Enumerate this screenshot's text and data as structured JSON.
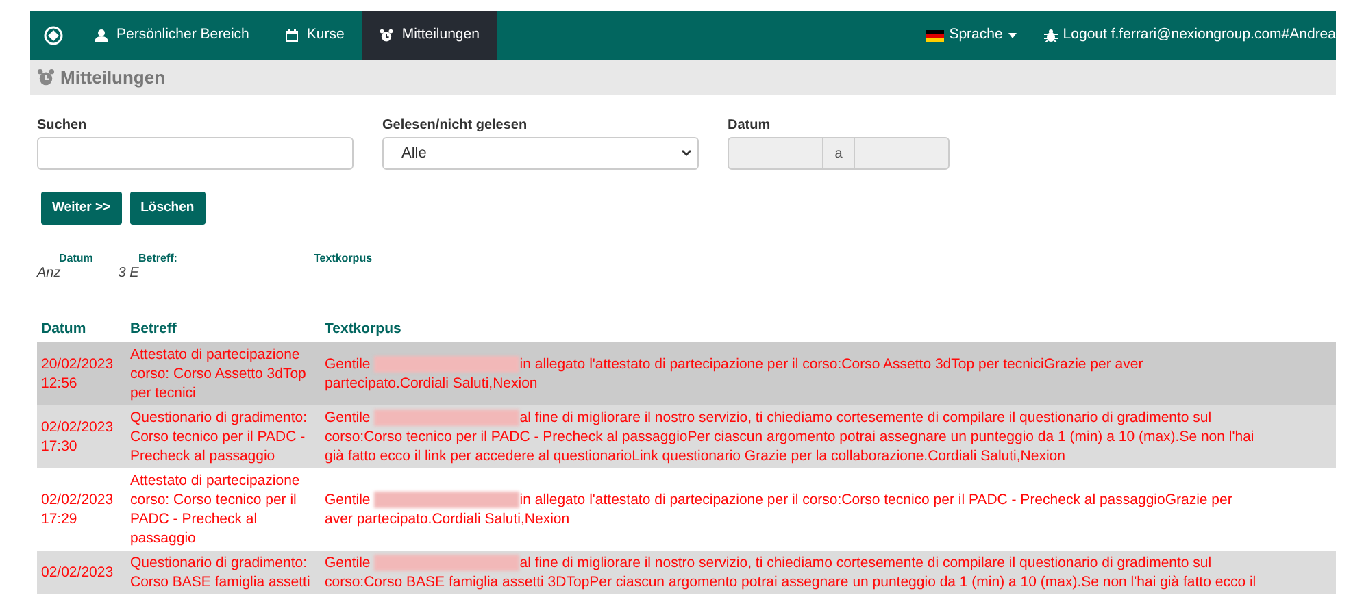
{
  "nav": {
    "items": [
      {
        "label": "Persönlicher Bereich",
        "selected": false
      },
      {
        "label": "Kurse",
        "selected": false
      },
      {
        "label": "Mitteilungen",
        "selected": true
      }
    ],
    "language": "Sprache",
    "logout": "Logout f.ferrari@nexiongroup.com#Andrea"
  },
  "page_title": "Mitteilungen",
  "filters": {
    "search_label": "Suchen",
    "read_label": "Gelesen/nicht gelesen",
    "read_value": "Alle",
    "date_label": "Datum",
    "date_separator": "a"
  },
  "buttons": [
    "Weiter >>",
    "Löschen"
  ],
  "result_fragments": [
    "Anz",
    "3 E"
  ],
  "floating_header": [
    "Datum",
    "Betreff:",
    "Textkorpus"
  ],
  "table": {
    "columns": [
      "Datum",
      "Betreff",
      "Textkorpus"
    ],
    "rows": [
      {
        "selected": true,
        "date": "20/02/2023",
        "time": "12:56",
        "subject": "Attestato di partecipazione corso: Corso Assetto 3dTop per tecnici",
        "greeting": "Gentile",
        "body_lines": [
          "in allegato l'attestato di partecipazione per il corso:Corso Assetto 3dTop per tecniciGrazie per aver",
          "partecipato.Cordiali Saluti,Nexion"
        ]
      },
      {
        "selected": false,
        "date": "02/02/2023",
        "time": "17:30",
        "subject": "Questionario di gradimento: Corso tecnico per il PADC - Precheck al passaggio",
        "greeting": "Gentile",
        "body_lines": [
          "al fine di migliorare il nostro servizio, ti chiediamo cortesemente di compilare il questionario di gradimento sul",
          "corso:Corso tecnico per il PADC - Precheck al passaggioPer ciascun argomento potrai assegnare un punteggio da 1 (min) a 10 (max).Se non l'hai",
          "già fatto ecco il link per accedere al questionarioLink questionario Grazie per la collaborazione.Cordiali Saluti,Nexion"
        ]
      },
      {
        "selected": false,
        "date": "02/02/2023",
        "time": "17:29",
        "subject": "Attestato di partecipazione corso: Corso tecnico per il PADC - Precheck al passaggio",
        "greeting": "Gentile",
        "body_lines": [
          "in allegato l'attestato di partecipazione per il corso:Corso tecnico per il PADC - Precheck al passaggioGrazie per",
          "aver partecipato.Cordiali Saluti,Nexion"
        ]
      },
      {
        "selected": false,
        "date": "02/02/2023",
        "subject": "Questionario di gradimento: Corso BASE famiglia assetti",
        "greeting": "Gentile",
        "body_lines": [
          "al fine di migliorare il nostro servizio, ti chiediamo cortesemente di compilare il questionario di gradimento sul",
          "corso:Corso BASE famiglia assetti 3DTopPer ciascun argomento potrai assegnare un punteggio da 1 (min) a 10 (max).Se non l'hai già fatto ecco il"
        ]
      }
    ]
  }
}
